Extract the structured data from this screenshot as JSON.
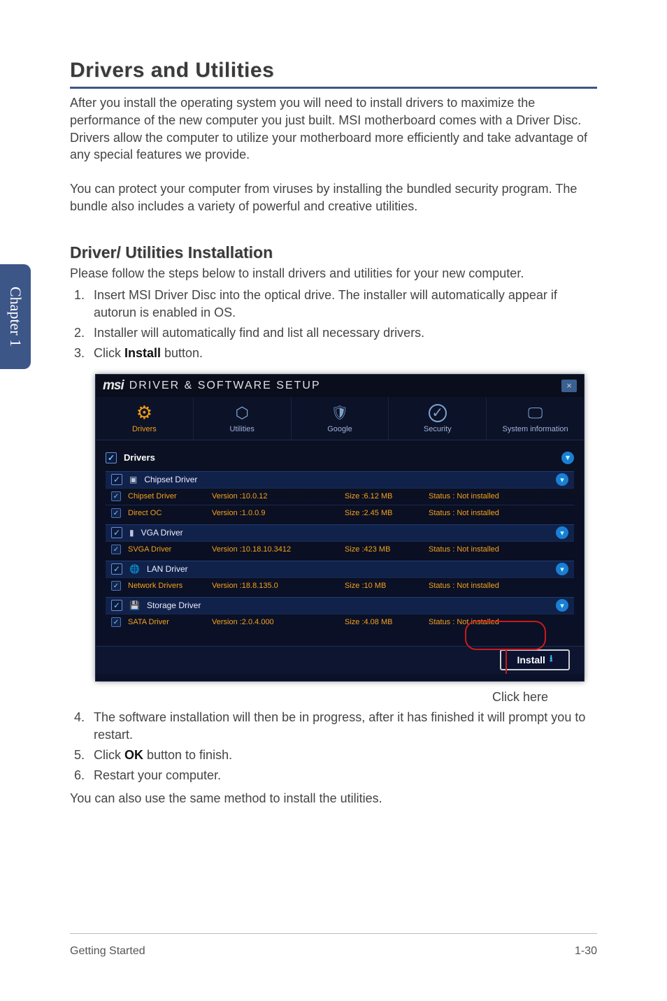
{
  "sideTab": "Chapter 1",
  "title": "Drivers and Utilities",
  "para1": "After you install the operating system you will need to install drivers to maximize the performance of the new computer you just built. MSI motherboard comes with a Driver Disc. Drivers allow the computer to utilize your motherboard more efficiently and take advantage of any special features we provide.",
  "para2": "You can protect your computer from viruses by installing the bundled security program. The bundle also includes a variety of powerful and creative utilities.",
  "subtitle": "Driver/ Utilities Installation",
  "para3": "Please follow the steps below to install drivers and utilities for your new computer.",
  "steps13": [
    "Insert MSI Driver Disc into the optical drive. The installer will automatically appear if autorun is enabled in OS.",
    "Installer will automatically find and list all necessary drivers.",
    "Click Install button."
  ],
  "installWord": "Install",
  "clickHere": "Click here",
  "steps46": [
    "The software installation will then be in progress, after it has finished it will prompt you to restart.",
    "Click OK button to finish.",
    "Restart your computer."
  ],
  "okWord": "OK",
  "para4": "You can also use the same method to install the utilities.",
  "footerLeft": "Getting Started",
  "footerRight": "1-30",
  "app": {
    "logo": "msi",
    "title": "DRIVER & SOFTWARE SETUP",
    "tabs": [
      "Drivers",
      "Utilities",
      "Google",
      "Security",
      "System information"
    ],
    "sectionHead": "Drivers",
    "groups": [
      {
        "label": "Chipset Driver",
        "icon": "▣",
        "rows": [
          {
            "name": "Chipset Driver",
            "ver": "Version :10.0.12",
            "size": "Size :6.12 MB",
            "status": "Status : Not installed"
          },
          {
            "name": "Direct OC",
            "ver": "Version :1.0.0.9",
            "size": "Size :2.45 MB",
            "status": "Status : Not installed"
          }
        ]
      },
      {
        "label": "VGA Driver",
        "icon": "▮",
        "rows": [
          {
            "name": "SVGA Driver",
            "ver": "Version :10.18.10.3412",
            "size": "Size :423 MB",
            "status": "Status : Not installed"
          }
        ]
      },
      {
        "label": "LAN Driver",
        "icon": "🌐",
        "rows": [
          {
            "name": "Network Drivers",
            "ver": "Version :18.8.135.0",
            "size": "Size :10 MB",
            "status": "Status : Not installed"
          }
        ]
      },
      {
        "label": "Storage Driver",
        "icon": "💾",
        "rows": [
          {
            "name": "SATA Driver",
            "ver": "Version :2.0.4.000",
            "size": "Size :4.08 MB",
            "status": "Status : Not installed"
          }
        ]
      }
    ],
    "installLabel": "Install"
  }
}
